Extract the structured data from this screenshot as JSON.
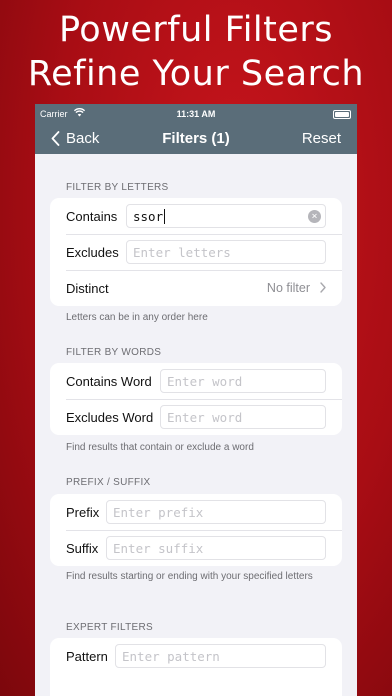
{
  "promo": {
    "line1": "Powerful Filters",
    "line2": "Refine Your Search"
  },
  "status_bar": {
    "carrier": "Carrier",
    "time": "11:31 AM"
  },
  "nav": {
    "back_label": "Back",
    "title": "Filters (1)",
    "reset_label": "Reset"
  },
  "letters": {
    "header": "FILTER BY LETTERS",
    "contains_label": "Contains",
    "contains_value": "ssor",
    "excludes_label": "Excludes",
    "excludes_placeholder": "Enter letters",
    "distinct_label": "Distinct",
    "distinct_value": "No filter",
    "footer": "Letters can be in any order here"
  },
  "words": {
    "header": "FILTER BY WORDS",
    "contains_label": "Contains Word",
    "contains_placeholder": "Enter word",
    "excludes_label": "Excludes Word",
    "excludes_placeholder": "Enter word",
    "footer": "Find results that contain or exclude a word"
  },
  "affix": {
    "header": "PREFIX / SUFFIX",
    "prefix_label": "Prefix",
    "prefix_placeholder": "Enter prefix",
    "suffix_label": "Suffix",
    "suffix_placeholder": "Enter suffix",
    "footer": "Find results starting or ending with your specified letters"
  },
  "expert": {
    "header": "EXPERT FILTERS",
    "pattern_label": "Pattern",
    "pattern_placeholder": "Enter pattern"
  }
}
